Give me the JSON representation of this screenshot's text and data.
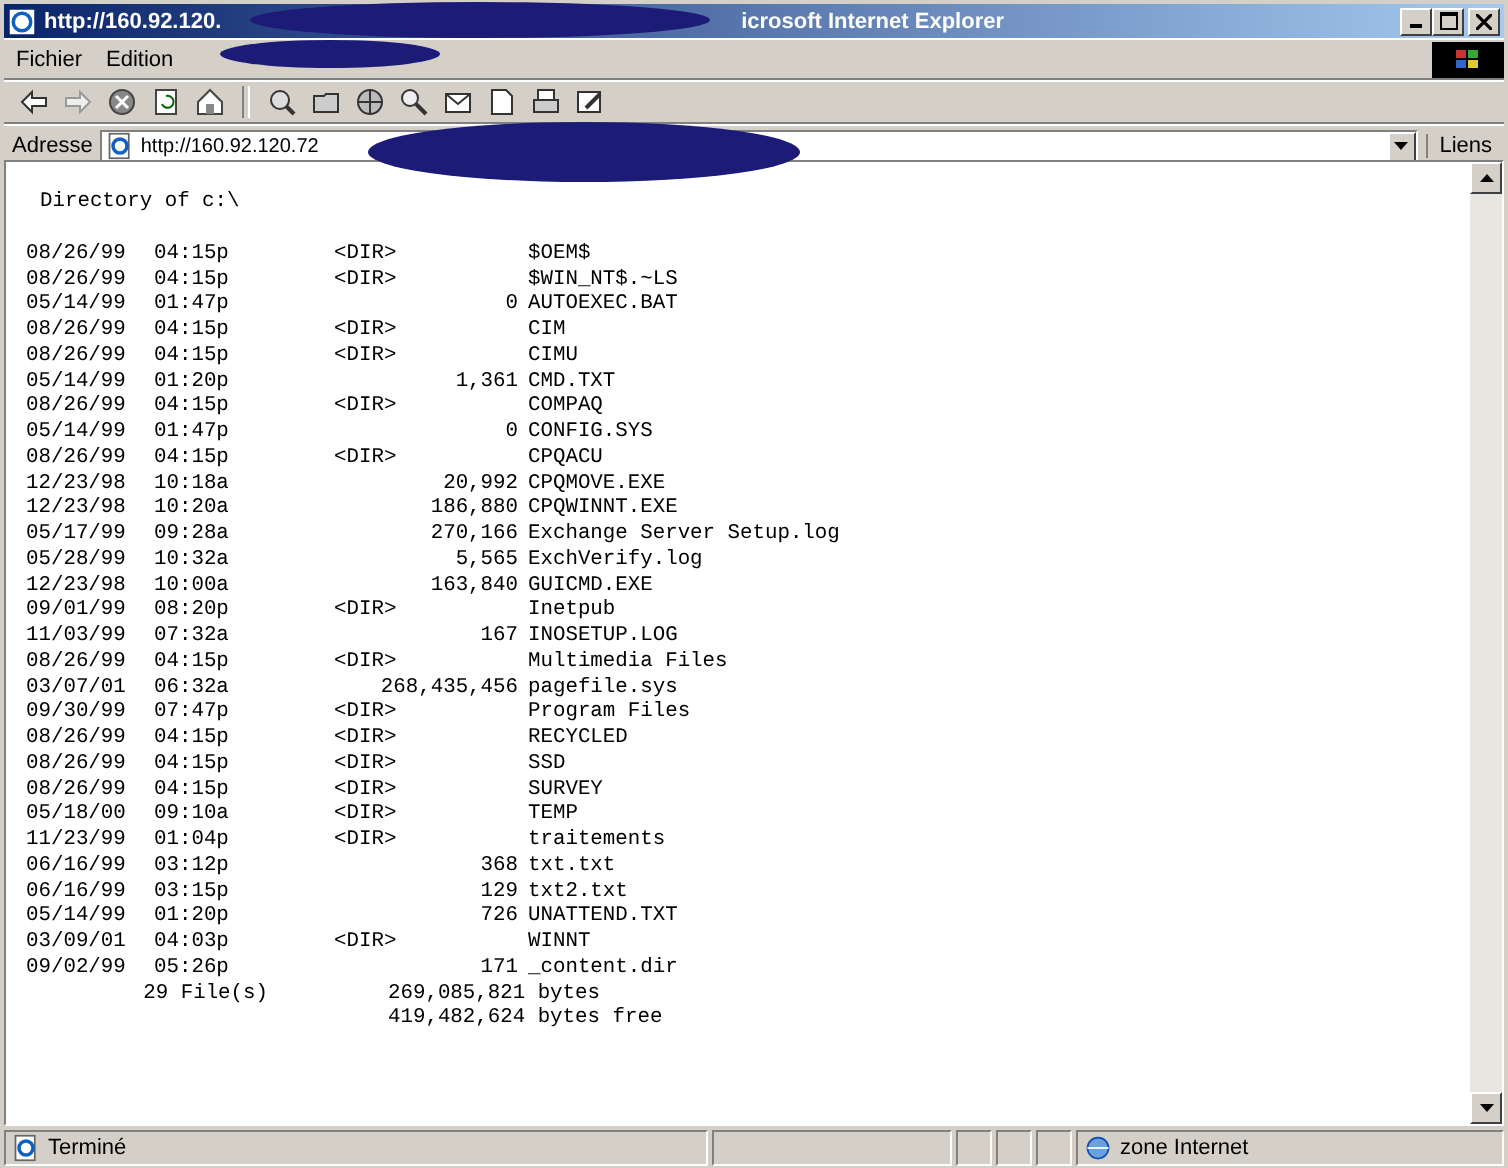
{
  "window": {
    "title_start": "http://160.92.120.",
    "title_end": "icrosoft Internet Explorer"
  },
  "menu": [
    "Fichier",
    "Edition"
  ],
  "address_bar": {
    "label": "Adresse",
    "value": "http://160.92.120.72",
    "links": "Liens"
  },
  "listing": {
    "heading": "Directory of c:\\",
    "rows": [
      {
        "date": "08/26/99",
        "time": "04:15p",
        "dir": "<DIR>",
        "name": "$OEM$"
      },
      {
        "date": "08/26/99",
        "time": "04:15p",
        "dir": "<DIR>",
        "name": "$WIN_NT$.~LS"
      },
      {
        "date": "05/14/99",
        "time": "01:47p",
        "size": "0",
        "name": "AUTOEXEC.BAT"
      },
      {
        "date": "08/26/99",
        "time": "04:15p",
        "dir": "<DIR>",
        "name": "CIM"
      },
      {
        "date": "08/26/99",
        "time": "04:15p",
        "dir": "<DIR>",
        "name": "CIMU"
      },
      {
        "date": "05/14/99",
        "time": "01:20p",
        "size": "1,361",
        "name": "CMD.TXT"
      },
      {
        "date": "08/26/99",
        "time": "04:15p",
        "dir": "<DIR>",
        "name": "COMPAQ"
      },
      {
        "date": "05/14/99",
        "time": "01:47p",
        "size": "0",
        "name": "CONFIG.SYS"
      },
      {
        "date": "08/26/99",
        "time": "04:15p",
        "dir": "<DIR>",
        "name": "CPQACU"
      },
      {
        "date": "12/23/98",
        "time": "10:18a",
        "size": "20,992",
        "name": "CPQMOVE.EXE"
      },
      {
        "date": "12/23/98",
        "time": "10:20a",
        "size": "186,880",
        "name": "CPQWINNT.EXE"
      },
      {
        "date": "05/17/99",
        "time": "09:28a",
        "size": "270,166",
        "name": "Exchange Server Setup.log"
      },
      {
        "date": "05/28/99",
        "time": "10:32a",
        "size": "5,565",
        "name": "ExchVerify.log"
      },
      {
        "date": "12/23/98",
        "time": "10:00a",
        "size": "163,840",
        "name": "GUICMD.EXE"
      },
      {
        "date": "09/01/99",
        "time": "08:20p",
        "dir": "<DIR>",
        "name": "Inetpub"
      },
      {
        "date": "11/03/99",
        "time": "07:32a",
        "size": "167",
        "name": "INOSETUP.LOG"
      },
      {
        "date": "08/26/99",
        "time": "04:15p",
        "dir": "<DIR>",
        "name": "Multimedia Files"
      },
      {
        "date": "03/07/01",
        "time": "06:32a",
        "size": "268,435,456",
        "name": "pagefile.sys"
      },
      {
        "date": "09/30/99",
        "time": "07:47p",
        "dir": "<DIR>",
        "name": "Program Files"
      },
      {
        "date": "08/26/99",
        "time": "04:15p",
        "dir": "<DIR>",
        "name": "RECYCLED"
      },
      {
        "date": "08/26/99",
        "time": "04:15p",
        "dir": "<DIR>",
        "name": "SSD"
      },
      {
        "date": "08/26/99",
        "time": "04:15p",
        "dir": "<DIR>",
        "name": "SURVEY"
      },
      {
        "date": "05/18/00",
        "time": "09:10a",
        "dir": "<DIR>",
        "name": "TEMP"
      },
      {
        "date": "11/23/99",
        "time": "01:04p",
        "dir": "<DIR>",
        "name": "traitements"
      },
      {
        "date": "06/16/99",
        "time": "03:12p",
        "size": "368",
        "name": "txt.txt"
      },
      {
        "date": "06/16/99",
        "time": "03:15p",
        "size": "129",
        "name": "txt2.txt"
      },
      {
        "date": "05/14/99",
        "time": "01:20p",
        "size": "726",
        "name": "UNATTEND.TXT"
      },
      {
        "date": "03/09/01",
        "time": "04:03p",
        "dir": "<DIR>",
        "name": "WINNT"
      },
      {
        "date": "09/02/99",
        "time": "05:26p",
        "size": "171",
        "name": "_content.dir"
      }
    ],
    "file_count": "29 File(s)",
    "total": "269,085,821 bytes",
    "free": "419,482,624 bytes free"
  },
  "status_bar": {
    "text": "Terminé",
    "zone": "zone Internet"
  }
}
